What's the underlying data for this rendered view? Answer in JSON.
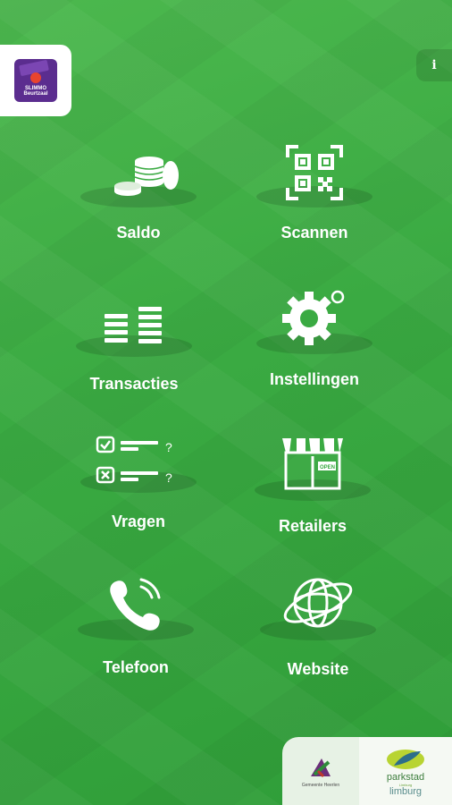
{
  "app_logo": {
    "text": "SLIMMO Beurtzaal"
  },
  "info_button": {
    "label": "i"
  },
  "tiles": [
    {
      "label": "Saldo",
      "icon": "coins-icon"
    },
    {
      "label": "Scannen",
      "icon": "qr-code-icon"
    },
    {
      "label": "Transacties",
      "icon": "transactions-list-icon"
    },
    {
      "label": "Instellingen",
      "icon": "gear-icon"
    },
    {
      "label": "Vragen",
      "icon": "checklist-question-icon"
    },
    {
      "label": "Retailers",
      "icon": "store-icon"
    },
    {
      "label": "Telefoon",
      "icon": "phone-icon"
    },
    {
      "label": "Website",
      "icon": "globe-icon"
    }
  ],
  "footer_badges": {
    "left_caption": "Gemeente Heerlen",
    "right_name": "parkstad",
    "right_sub": "Limburg",
    "right_region": "limburg"
  },
  "colors": {
    "background": "#3aaa42",
    "logo_purple": "#5b2d8f",
    "logo_red": "#e9442f",
    "label_white": "#ffffff"
  }
}
